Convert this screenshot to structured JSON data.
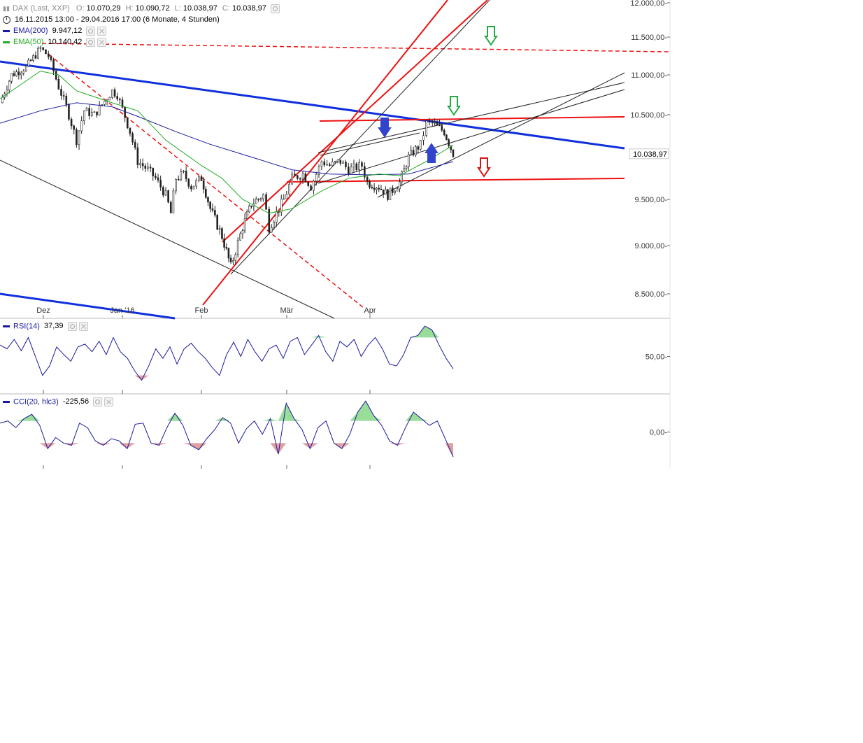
{
  "header": {
    "symbol": "DAX (Last, XXP)",
    "open_label": "O:",
    "open": "10.070,29",
    "high_label": "H:",
    "high": "10.090,72",
    "low_label": "L:",
    "low": "10.038,97",
    "close_label": "C:",
    "close": "10.038,97",
    "range": "16.11.2015 13:00 - 29.04.2016 17:00 (6 Monate, 4 Stunden)",
    "ema200_label": "EMA(200)",
    "ema200_value": "9.947,12",
    "ema50_label": "EMA(50)",
    "ema50_value": "10.140,42"
  },
  "indicators": {
    "rsi_label": "RSI(14)",
    "rsi_value": "37,39",
    "cci_label": "CCI(20, hlc3)",
    "cci_value": "-225,56"
  },
  "colors": {
    "ema200": "#1a1aa0",
    "ema50": "#22aa22",
    "red_line": "#ee1111",
    "blue_line": "#1030dd",
    "arrow_green": "#22aa44",
    "arrow_red": "#dd1111",
    "arrow_blue": "#3344cc",
    "pos_fill": "#99dd99",
    "neg_fill": "#e0a0a0"
  },
  "chart_data": {
    "type": "candlestick",
    "instrument": "DAX",
    "x_ticks": [
      "Dez",
      "Jan '16",
      "Feb",
      "Mär",
      "Apr"
    ],
    "y_ticks": [
      "12.000,00",
      "11.500,00",
      "11.000,00",
      "10.500,00",
      "9.500,00",
      "9.000,00",
      "8.500,00"
    ],
    "y_tick_values": [
      12000,
      11500,
      11000,
      10500,
      9500,
      9000,
      8500
    ],
    "last_price_label": "10.038,97",
    "last_price": 10038.97,
    "ylim": [
      8400,
      12000
    ],
    "close_path": [
      {
        "d": "2015-11-16",
        "c": 10650
      },
      {
        "d": "2015-11-20",
        "c": 11000
      },
      {
        "d": "2015-11-25",
        "c": 11100
      },
      {
        "d": "2015-11-30",
        "c": 11350
      },
      {
        "d": "2015-12-03",
        "c": 11250
      },
      {
        "d": "2015-12-07",
        "c": 10850
      },
      {
        "d": "2015-12-10",
        "c": 10600
      },
      {
        "d": "2015-12-14",
        "c": 10200
      },
      {
        "d": "2015-12-17",
        "c": 10550
      },
      {
        "d": "2015-12-21",
        "c": 10500
      },
      {
        "d": "2015-12-28",
        "c": 10800
      },
      {
        "d": "2015-12-30",
        "c": 10750
      },
      {
        "d": "2016-01-04",
        "c": 10300
      },
      {
        "d": "2016-01-07",
        "c": 9950
      },
      {
        "d": "2016-01-11",
        "c": 9850
      },
      {
        "d": "2016-01-14",
        "c": 9750
      },
      {
        "d": "2016-01-18",
        "c": 9550
      },
      {
        "d": "2016-01-20",
        "c": 9350
      },
      {
        "d": "2016-01-22",
        "c": 9750
      },
      {
        "d": "2016-01-25",
        "c": 9800
      },
      {
        "d": "2016-01-28",
        "c": 9650
      },
      {
        "d": "2016-02-01",
        "c": 9750
      },
      {
        "d": "2016-02-04",
        "c": 9400
      },
      {
        "d": "2016-02-08",
        "c": 9100
      },
      {
        "d": "2016-02-11",
        "c": 8780
      },
      {
        "d": "2016-02-15",
        "c": 9200
      },
      {
        "d": "2016-02-18",
        "c": 9450
      },
      {
        "d": "2016-02-22",
        "c": 9550
      },
      {
        "d": "2016-02-24",
        "c": 9200
      },
      {
        "d": "2016-02-29",
        "c": 9500
      },
      {
        "d": "2016-03-03",
        "c": 9750
      },
      {
        "d": "2016-03-07",
        "c": 9800
      },
      {
        "d": "2016-03-10",
        "c": 9650
      },
      {
        "d": "2016-03-14",
        "c": 9950
      },
      {
        "d": "2016-03-17",
        "c": 9900
      },
      {
        "d": "2016-03-21",
        "c": 9950
      },
      {
        "d": "2016-03-24",
        "c": 9850
      },
      {
        "d": "2016-03-29",
        "c": 9900
      },
      {
        "d": "2016-03-31",
        "c": 9700
      },
      {
        "d": "2016-04-04",
        "c": 9650
      },
      {
        "d": "2016-04-07",
        "c": 9550
      },
      {
        "d": "2016-04-11",
        "c": 9700
      },
      {
        "d": "2016-04-14",
        "c": 10000
      },
      {
        "d": "2016-04-18",
        "c": 10150
      },
      {
        "d": "2016-04-20",
        "c": 10400
      },
      {
        "d": "2016-04-22",
        "c": 10400
      },
      {
        "d": "2016-04-26",
        "c": 10300
      },
      {
        "d": "2016-04-29",
        "c": 10039
      }
    ],
    "ema50_path": [
      {
        "d": "2015-11-16",
        "v": 10700
      },
      {
        "d": "2015-11-30",
        "v": 11050
      },
      {
        "d": "2015-12-07",
        "v": 11000
      },
      {
        "d": "2015-12-14",
        "v": 10800
      },
      {
        "d": "2015-12-28",
        "v": 10650
      },
      {
        "d": "2016-01-07",
        "v": 10550
      },
      {
        "d": "2016-01-18",
        "v": 10200
      },
      {
        "d": "2016-02-01",
        "v": 9900
      },
      {
        "d": "2016-02-08",
        "v": 9750
      },
      {
        "d": "2016-02-15",
        "v": 9500
      },
      {
        "d": "2016-02-24",
        "v": 9350
      },
      {
        "d": "2016-03-03",
        "v": 9400
      },
      {
        "d": "2016-03-14",
        "v": 9600
      },
      {
        "d": "2016-03-24",
        "v": 9750
      },
      {
        "d": "2016-04-04",
        "v": 9800
      },
      {
        "d": "2016-04-11",
        "v": 9780
      },
      {
        "d": "2016-04-20",
        "v": 9950
      },
      {
        "d": "2016-04-29",
        "v": 10140
      }
    ],
    "ema200_path": [
      {
        "d": "2015-11-16",
        "v": 10400
      },
      {
        "d": "2015-11-30",
        "v": 10550
      },
      {
        "d": "2015-12-14",
        "v": 10650
      },
      {
        "d": "2015-12-28",
        "v": 10600
      },
      {
        "d": "2016-01-07",
        "v": 10480
      },
      {
        "d": "2016-01-22",
        "v": 10300
      },
      {
        "d": "2016-02-04",
        "v": 10150
      },
      {
        "d": "2016-02-18",
        "v": 10000
      },
      {
        "d": "2016-03-03",
        "v": 9850
      },
      {
        "d": "2016-03-17",
        "v": 9800
      },
      {
        "d": "2016-03-31",
        "v": 9790
      },
      {
        "d": "2016-04-14",
        "v": 9800
      },
      {
        "d": "2016-04-29",
        "v": 9947
      }
    ],
    "rsi": {
      "label": "RSI(14)",
      "value": 37.39,
      "ylim": [
        15,
        85
      ],
      "y_tick": "50,00",
      "y_tick_value": 50,
      "upper": 70,
      "lower": 30,
      "path": [
        62,
        58,
        68,
        56,
        70,
        50,
        30,
        40,
        60,
        52,
        45,
        60,
        63,
        55,
        66,
        52,
        70,
        55,
        48,
        35,
        25,
        40,
        58,
        48,
        60,
        42,
        58,
        64,
        55,
        48,
        38,
        30,
        52,
        65,
        50,
        68,
        55,
        45,
        58,
        62,
        48,
        66,
        70,
        52,
        62,
        72,
        55,
        45,
        66,
        60,
        68,
        50,
        62,
        70,
        58,
        42,
        40,
        52,
        70,
        72,
        82,
        78,
        62,
        48,
        37
      ]
    },
    "cci": {
      "label": "CCI(20, hlc3)",
      "value": -225.56,
      "ylim": [
        -300,
        300
      ],
      "y_tick": "0,00",
      "y_tick_value": 0,
      "upper": 100,
      "lower": -100,
      "path": [
        80,
        100,
        40,
        120,
        160,
        60,
        -150,
        -50,
        -100,
        -120,
        80,
        40,
        -80,
        -120,
        -60,
        -80,
        -150,
        70,
        80,
        -100,
        -120,
        40,
        170,
        60,
        -120,
        -160,
        -60,
        20,
        130,
        80,
        -100,
        30,
        100,
        -20,
        120,
        -200,
        260,
        120,
        20,
        -150,
        40,
        100,
        -100,
        -150,
        -20,
        180,
        280,
        150,
        60,
        -80,
        -120,
        40,
        180,
        120,
        60,
        100,
        -60,
        -225
      ]
    }
  }
}
